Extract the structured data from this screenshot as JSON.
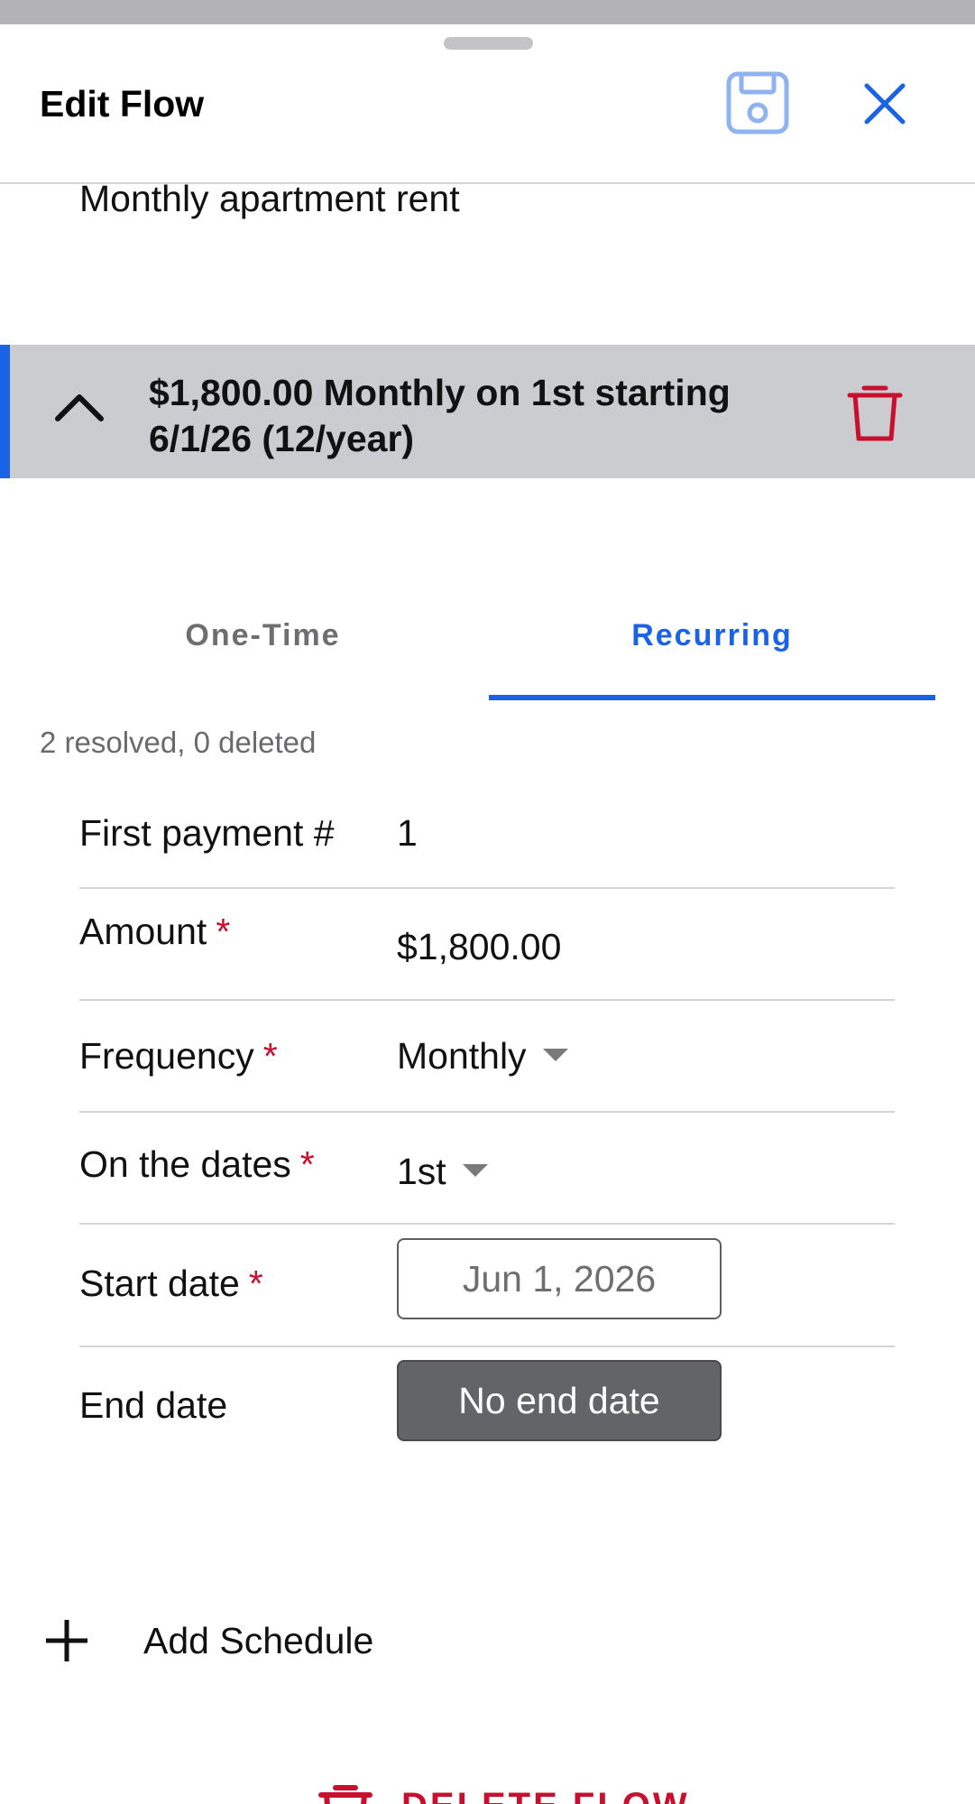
{
  "header": {
    "title": "Edit Flow",
    "save_icon": "save-icon",
    "close_icon": "close-icon"
  },
  "flow": {
    "description": "Monthly apartment rent"
  },
  "schedule": {
    "summary": "$1,800.00 Monthly on 1st starting 6/1/26 (12/year)",
    "expanded": true,
    "accent_color": "#1a63e6"
  },
  "tabs": [
    {
      "label": "One-Time",
      "active": false
    },
    {
      "label": "Recurring",
      "active": true
    }
  ],
  "status": "2 resolved, 0 deleted",
  "form": {
    "first_payment": {
      "label": "First payment #",
      "value": "1"
    },
    "amount": {
      "label": "Amount",
      "required_mark": "*",
      "value": "$1,800.00"
    },
    "frequency": {
      "label": "Frequency",
      "required_mark": "*",
      "value": "Monthly"
    },
    "dates": {
      "label": "On the dates",
      "required_mark": "*",
      "value": "1st"
    },
    "start_date": {
      "label": "Start date",
      "required_mark": "*",
      "value": "Jun 1, 2026"
    },
    "end_date": {
      "label": "End date",
      "value": "No end date"
    }
  },
  "actions": {
    "add_schedule": "Add Schedule",
    "delete_flow": "DELETE FLOW"
  },
  "colors": {
    "accent": "#1a63e6",
    "danger": "#c8102e",
    "required": "#c8102e"
  }
}
